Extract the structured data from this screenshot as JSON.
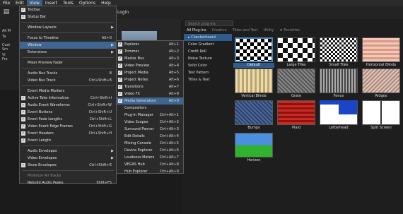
{
  "menubar": {
    "items": [
      "File",
      "Edit",
      "View",
      "Insert",
      "Tools",
      "Options",
      "Help"
    ],
    "active_index": 2
  },
  "login_label": "Login",
  "left_panel": {
    "items": [
      "All M",
      "Ta",
      "Cust",
      "Sm",
      "Vi",
      "Fro"
    ]
  },
  "view_menu": {
    "items": [
      {
        "label": "Toolbar",
        "shortcut": "",
        "checked": true,
        "submenu": false
      },
      {
        "label": "Status Bar",
        "shortcut": "",
        "checked": true,
        "submenu": false
      },
      {
        "sep": true
      },
      {
        "label": "Window Layouts",
        "shortcut": "",
        "checked": false,
        "submenu": true
      },
      {
        "sep": true
      },
      {
        "label": "Focus to Timeline",
        "shortcut": "Alt+0",
        "checked": false,
        "submenu": false
      },
      {
        "label": "Window",
        "shortcut": "",
        "checked": false,
        "submenu": true,
        "highlight": true
      },
      {
        "label": "Extensions",
        "shortcut": "",
        "checked": false,
        "submenu": true
      },
      {
        "sep": true
      },
      {
        "label": "Mixer Preview Fader",
        "shortcut": "",
        "checked": false,
        "submenu": false
      },
      {
        "sep": true
      },
      {
        "label": "Audio Bus Tracks",
        "shortcut": "B",
        "checked": false,
        "submenu": false
      },
      {
        "label": "Video Bus Track",
        "shortcut": "Ctrl+Shift+B",
        "checked": false,
        "submenu": false
      },
      {
        "sep": true
      },
      {
        "label": "Event Media Markers",
        "shortcut": "",
        "checked": false,
        "submenu": false
      },
      {
        "label": "Active Take Information",
        "shortcut": "Ctrl+Shift+I",
        "checked": true,
        "submenu": false
      },
      {
        "label": "Audio Event Waveforms",
        "shortcut": "Ctrl+Shift+W",
        "checked": true,
        "submenu": false
      },
      {
        "label": "Event Buttons",
        "shortcut": "Ctrl+Shift+U",
        "checked": true,
        "submenu": false
      },
      {
        "label": "Event Fade Lengths",
        "shortcut": "Ctrl+Shift+L",
        "checked": true,
        "submenu": false
      },
      {
        "label": "Video Event Edge Frames",
        "shortcut": "Ctrl+Shift+G",
        "checked": true,
        "submenu": false
      },
      {
        "label": "Event Headers",
        "shortcut": "Ctrl+Shift+H",
        "checked": true,
        "submenu": false
      },
      {
        "label": "Event Length",
        "shortcut": "",
        "checked": true,
        "submenu": false
      },
      {
        "sep": true
      },
      {
        "label": "Audio Envelopes",
        "shortcut": "",
        "checked": false,
        "submenu": true
      },
      {
        "label": "Video Envelopes",
        "shortcut": "",
        "checked": false,
        "submenu": true
      },
      {
        "label": "Show Envelopes",
        "shortcut": "Ctrl+Shift+E",
        "checked": true,
        "submenu": false
      },
      {
        "sep": true
      },
      {
        "label": "Minimize All Tracks",
        "shortcut": "",
        "checked": false,
        "submenu": false,
        "disabled": true
      },
      {
        "label": "Rebuild Audio Peaks",
        "shortcut": "Shift+F5",
        "checked": false,
        "submenu": false
      }
    ]
  },
  "window_menu": {
    "items": [
      {
        "label": "Explorer",
        "shortcut": "Alt+1",
        "checked": true
      },
      {
        "label": "Trimmer",
        "shortcut": "Alt+2",
        "checked": true
      },
      {
        "label": "Master Bus",
        "shortcut": "Alt+3",
        "checked": true
      },
      {
        "label": "Video Preview",
        "shortcut": "Alt+4",
        "checked": true
      },
      {
        "label": "Project Media",
        "shortcut": "Alt+5",
        "checked": true
      },
      {
        "label": "Project Notes",
        "shortcut": "Alt+6",
        "checked": true
      },
      {
        "label": "Transitions",
        "shortcut": "Alt+7",
        "checked": true
      },
      {
        "label": "Video FX",
        "shortcut": "Alt+8",
        "checked": true
      },
      {
        "label": "Media Generators",
        "shortcut": "Alt+9",
        "checked": true,
        "highlight": true
      },
      {
        "label": "Compositors",
        "shortcut": "",
        "checked": false
      },
      {
        "label": "Plug-In Manager",
        "shortcut": "Ctrl+Alt+1",
        "checked": false
      },
      {
        "label": "Video Scopes",
        "shortcut": "Ctrl+Alt+2",
        "checked": false
      },
      {
        "label": "Surround Panner",
        "shortcut": "Ctrl+Alt+3",
        "checked": false
      },
      {
        "label": "Edit Details",
        "shortcut": "Ctrl+Alt+4",
        "checked": false
      },
      {
        "label": "Mixing Console",
        "shortcut": "Ctrl+Alt+5",
        "checked": false
      },
      {
        "label": "Device Explorer",
        "shortcut": "Ctrl+Alt+6",
        "checked": false
      },
      {
        "label": "Loudness Meters",
        "shortcut": "Ctrl+Alt+7",
        "checked": false
      },
      {
        "label": "VEGAS Hub",
        "shortcut": "Ctrl+Alt+8",
        "checked": false
      },
      {
        "label": "Hub Explorer",
        "shortcut": "Ctrl+Alt+9",
        "checked": false
      }
    ]
  },
  "plugin_panel": {
    "search_placeholder": "Search plug-ins",
    "tabs": [
      "All Plug-Ins",
      "Creative",
      "Titles and Text",
      "Utility",
      "Favorites"
    ],
    "list": [
      "Checkerboard",
      "Color Gradient",
      "Credit Roll",
      "Noise Texture",
      "Solid Color",
      "Test Pattern",
      "Titles & Text"
    ],
    "selected_list_index": 0,
    "presets": [
      "Default",
      "Large Tiles",
      "Small Tiles",
      "Horizontal Blinds",
      "Vertical Blinds",
      "Grate",
      "Fence",
      "Ridges",
      "Bumps",
      "Plaid",
      "Letterhead",
      "Split Screen",
      "Horizon"
    ],
    "selected_preset_index": 0
  }
}
